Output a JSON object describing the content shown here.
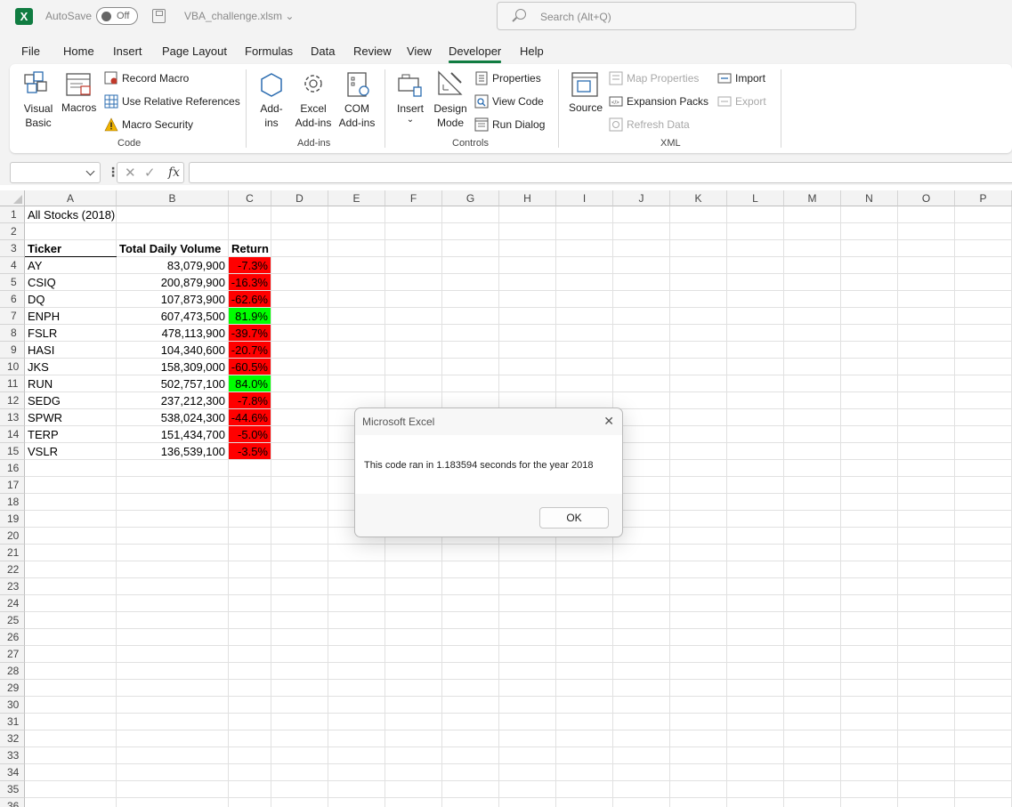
{
  "titlebar": {
    "app_icon": "excel-logo",
    "app_icon_letter": "X",
    "autosave_label": "AutoSave",
    "autosave_state": "Off",
    "filename": "VBA_challenge.xlsm",
    "search_placeholder": "Search (Alt+Q)"
  },
  "tabs": [
    "File",
    "Home",
    "Insert",
    "Page Layout",
    "Formulas",
    "Data",
    "Review",
    "View",
    "Developer",
    "Help"
  ],
  "active_tab": "Developer",
  "ribbon": {
    "code": {
      "group": "Code",
      "visual_basic": [
        "Visual",
        "Basic"
      ],
      "macros": "Macros",
      "record_macro": "Record Macro",
      "relative_refs": "Use Relative References",
      "macro_security": "Macro Security"
    },
    "addins": {
      "group": "Add-ins",
      "addins": [
        "Add-",
        "ins"
      ],
      "excel_addins": [
        "Excel",
        "Add-ins"
      ],
      "com_addins": [
        "COM",
        "Add-ins"
      ]
    },
    "controls": {
      "group": "Controls",
      "insert": "Insert",
      "design_mode": [
        "Design",
        "Mode"
      ],
      "properties": "Properties",
      "view_code": "View Code",
      "run_dialog": "Run Dialog"
    },
    "xml": {
      "group": "XML",
      "source": "Source",
      "map_properties": "Map Properties",
      "expansion_packs": "Expansion Packs",
      "refresh_data": "Refresh Data",
      "import": "Import",
      "export": "Export"
    }
  },
  "formula_bar": {
    "name_box": "",
    "fx": "fx",
    "formula": ""
  },
  "columns": [
    "A",
    "B",
    "C",
    "D",
    "E",
    "F",
    "G",
    "H",
    "I",
    "J",
    "K",
    "L",
    "M",
    "N",
    "O",
    "P"
  ],
  "rows": [
    "1",
    "2",
    "3",
    "4",
    "5",
    "6",
    "7",
    "8",
    "9",
    "10",
    "11",
    "12",
    "13",
    "14",
    "15",
    "16",
    "17",
    "18",
    "19",
    "20",
    "21",
    "22",
    "23",
    "24",
    "25",
    "26",
    "27",
    "28",
    "29",
    "30",
    "31",
    "32",
    "33",
    "34",
    "35",
    "36"
  ],
  "sheet": {
    "title": "All Stocks (2018)",
    "headers": [
      "Ticker",
      "Total Daily Volume",
      "Return"
    ],
    "data": [
      {
        "ticker": "AY",
        "volume": "83,079,900",
        "ret": "-7.3%",
        "positive": false
      },
      {
        "ticker": "CSIQ",
        "volume": "200,879,900",
        "ret": "-16.3%",
        "positive": false
      },
      {
        "ticker": "DQ",
        "volume": "107,873,900",
        "ret": "-62.6%",
        "positive": false
      },
      {
        "ticker": "ENPH",
        "volume": "607,473,500",
        "ret": "81.9%",
        "positive": true
      },
      {
        "ticker": "FSLR",
        "volume": "478,113,900",
        "ret": "-39.7%",
        "positive": false
      },
      {
        "ticker": "HASI",
        "volume": "104,340,600",
        "ret": "-20.7%",
        "positive": false
      },
      {
        "ticker": "JKS",
        "volume": "158,309,000",
        "ret": "-60.5%",
        "positive": false
      },
      {
        "ticker": "RUN",
        "volume": "502,757,100",
        "ret": "84.0%",
        "positive": true
      },
      {
        "ticker": "SEDG",
        "volume": "237,212,300",
        "ret": "-7.8%",
        "positive": false
      },
      {
        "ticker": "SPWR",
        "volume": "538,024,300",
        "ret": "-44.6%",
        "positive": false
      },
      {
        "ticker": "TERP",
        "volume": "151,434,700",
        "ret": "-5.0%",
        "positive": false
      },
      {
        "ticker": "VSLR",
        "volume": "136,539,100",
        "ret": "-3.5%",
        "positive": false
      }
    ]
  },
  "colors": {
    "accent": "#107c41",
    "negative": "#ff0000",
    "positive": "#00ff00"
  },
  "dialog": {
    "title": "Microsoft Excel",
    "message": "This code ran in 1.183594 seconds for the year 2018",
    "ok_label": "OK"
  }
}
